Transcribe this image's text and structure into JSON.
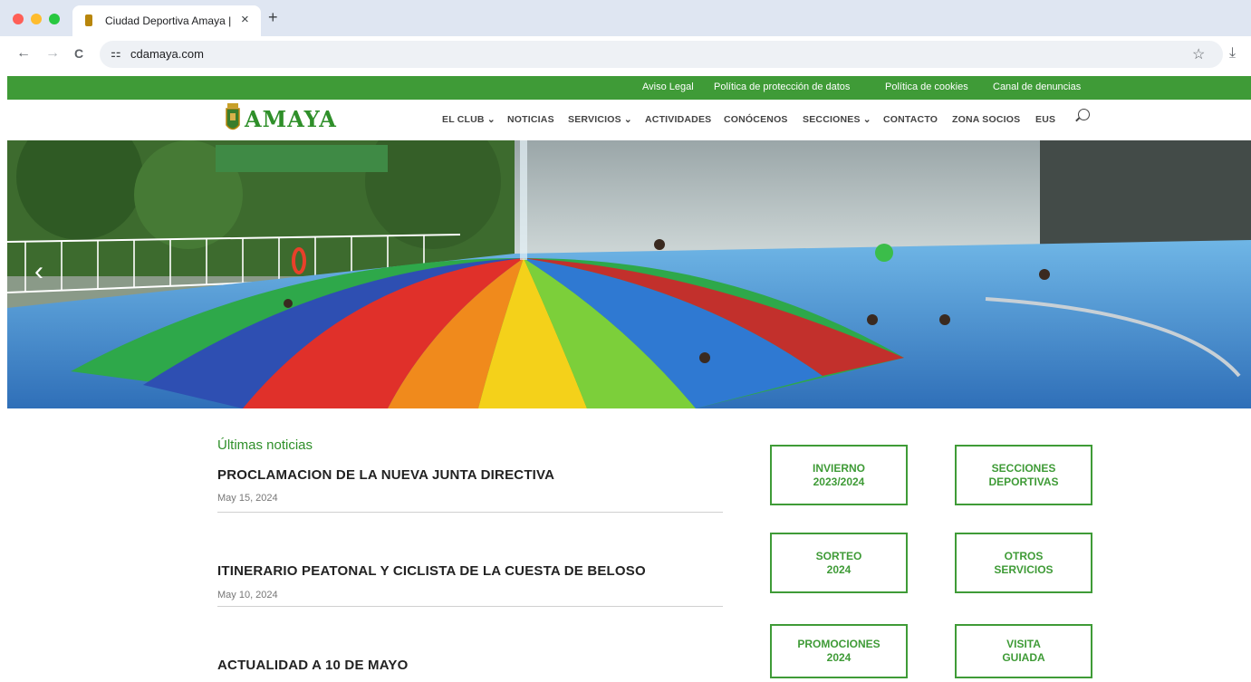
{
  "browser": {
    "tab_title": "Ciudad Deportiva Amaya |",
    "tab_close": "×",
    "new_tab": "+",
    "url": "cdamaya.com",
    "icons": [
      "back-icon",
      "forward-icon",
      "reload-icon",
      "site-settings-icon",
      "bookmark-star-icon",
      "download-icon"
    ],
    "glyphs": {
      "back": "←",
      "forward": "→",
      "reload": "C",
      "site": "⚏",
      "star": "☆",
      "download": "⤓"
    },
    "colors": {
      "close": "#ff5f57",
      "minimize": "#febc2e",
      "maximize": "#28c840"
    }
  },
  "topbar": {
    "links": [
      "Aviso Legal",
      "Política de protección de datos",
      "Política de cookies",
      "Canal de denuncias"
    ],
    "color": "#3f9b37"
  },
  "header": {
    "logo_text": "AMAYA",
    "menu": [
      "EL CLUB ⌄",
      "NOTICIAS",
      "SERVICIOS ⌄",
      "ACTIVIDADES",
      "CONÓCENOS",
      "SECCIONES ⌄",
      "CONTACTO",
      "ZONA SOCIOS",
      "EUS"
    ]
  },
  "hero": {
    "prev_arrow": "‹"
  },
  "news": {
    "section_title": "Últimas noticias",
    "items": [
      {
        "title": "PROCLAMACION DE LA NUEVA JUNTA DIRECTIVA",
        "date": "May 15, 2024"
      },
      {
        "title": "ITINERARIO PEATONAL Y CICLISTA DE LA CUESTA DE BELOSO",
        "date": "May 10, 2024"
      },
      {
        "title": "ACTUALIDAD A 10 DE MAYO",
        "date": ""
      }
    ]
  },
  "boxes": [
    "INVIERNO\n2023/2024",
    "SECCIONES\nDEPORTIVAS",
    "SORTEO\n2024",
    "OTROS\nSERVICIOS",
    "PROMOCIONES\n2024",
    "VISITA\nGUIADA"
  ]
}
